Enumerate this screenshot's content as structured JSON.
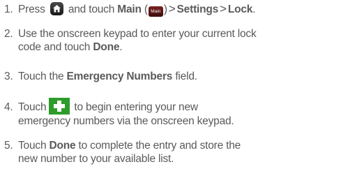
{
  "steps": [
    {
      "num": "1.",
      "t1": "Press",
      "t2": "and touch",
      "main_label": "Main",
      "paren_open": "(",
      "main_icon_text": "Main",
      "paren_close": ")",
      "sep1": ">",
      "settings_label": "Settings",
      "sep2": ">",
      "lock_label": "Lock",
      "end": "."
    },
    {
      "num": "2.",
      "line1": "Use the onscreen keypad to enter your current lock",
      "line2_pre": "code and touch",
      "done_label": "Done",
      "end": "."
    },
    {
      "num": "3.",
      "pre": "Touch the",
      "field_label": "Emergency Numbers",
      "post": "field."
    },
    {
      "num": "4.",
      "pre": "Touch",
      "line1_post": "to begin entering your new",
      "line2": "emergency numbers via the onscreen keypad."
    },
    {
      "num": "5.",
      "pre": "Touch",
      "done_label": "Done",
      "line1_post": "to complete the entry and store the",
      "line2": "new number to your available list."
    }
  ],
  "icons": {
    "home": "home-icon",
    "main": "main-menu-icon",
    "plus": "plus-icon"
  },
  "colors": {
    "text": "#5a5a5a",
    "plus_bg": "#2e9c2a",
    "main_icon_bg": "#5a1414"
  }
}
